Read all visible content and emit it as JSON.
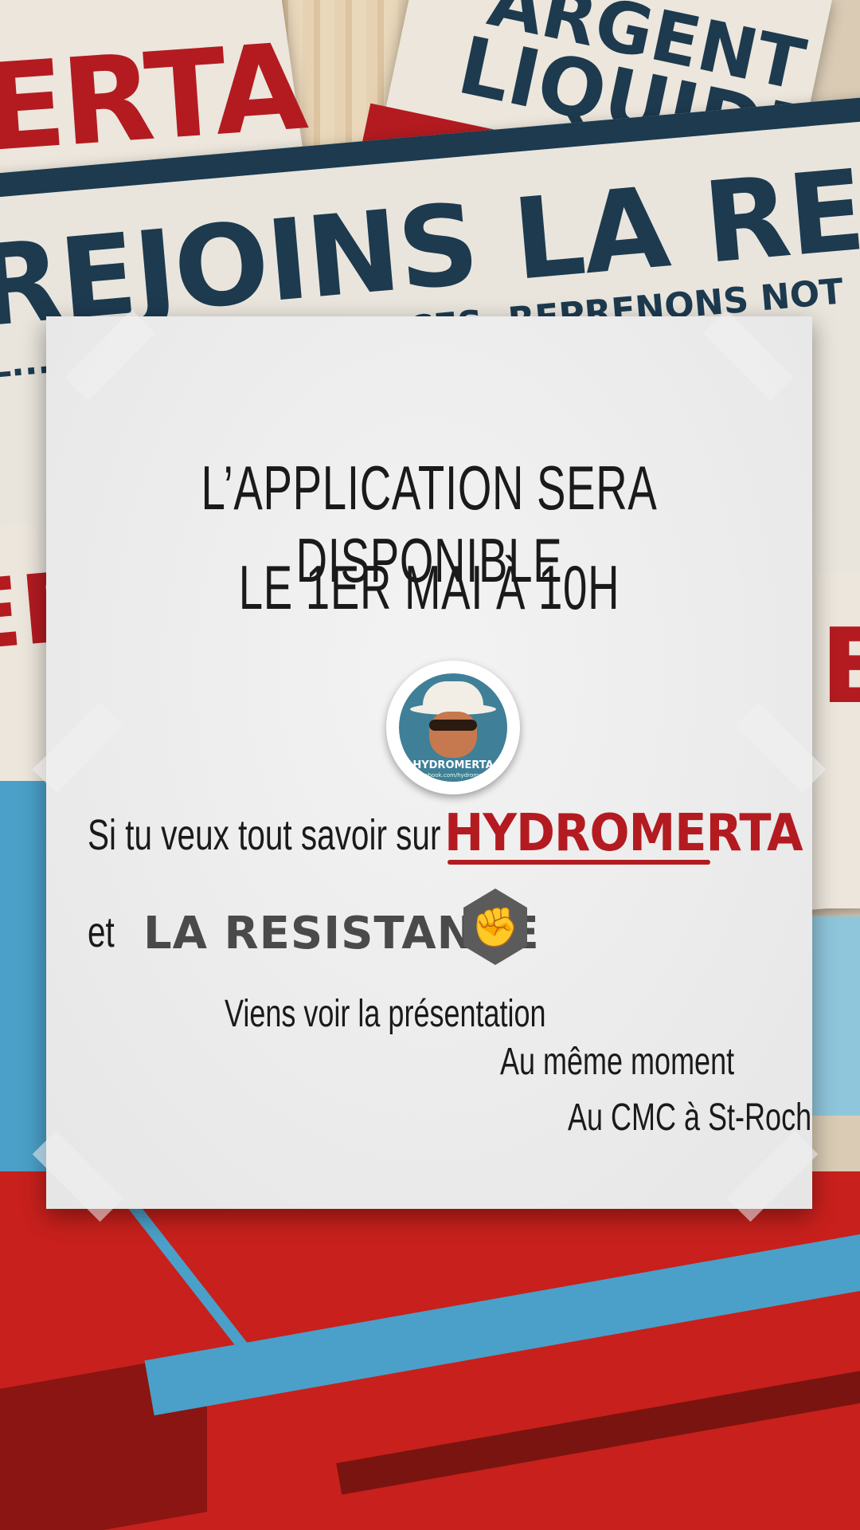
{
  "background": {
    "poster_top_left": "ERTA",
    "poster_top_right_line1": "ARGENT",
    "poster_top_right_line2": "LIQUIDE",
    "poster_main_title": "REJOINS LA RESIST",
    "poster_main_subtitle": "IL... NT NOS RESSOURCES, REPRENONS NOT",
    "side_left": "ERT",
    "side_right": "E"
  },
  "note": {
    "headline_line1": "L’APPLICATION SERA DISPONIBLE",
    "headline_line2": "LE 1ER MAI À 10H",
    "line_si": "Si tu veux tout savoir sur",
    "brand_hydro": "HYDROMERTA",
    "line_et": "et",
    "brand_resistance": "LA RESISTANCE",
    "line_viens": "Viens voir la présentation",
    "line_meme": "Au même moment",
    "line_cmc": "Au CMC à St-Roch",
    "logo_name": "HYDROMERTA",
    "logo_facebook": "facebook.com/hydromerta"
  },
  "colors": {
    "brand_red": "#b31b20",
    "brand_navy": "#1d3a4f",
    "brand_blue": "#4aa0c8"
  }
}
